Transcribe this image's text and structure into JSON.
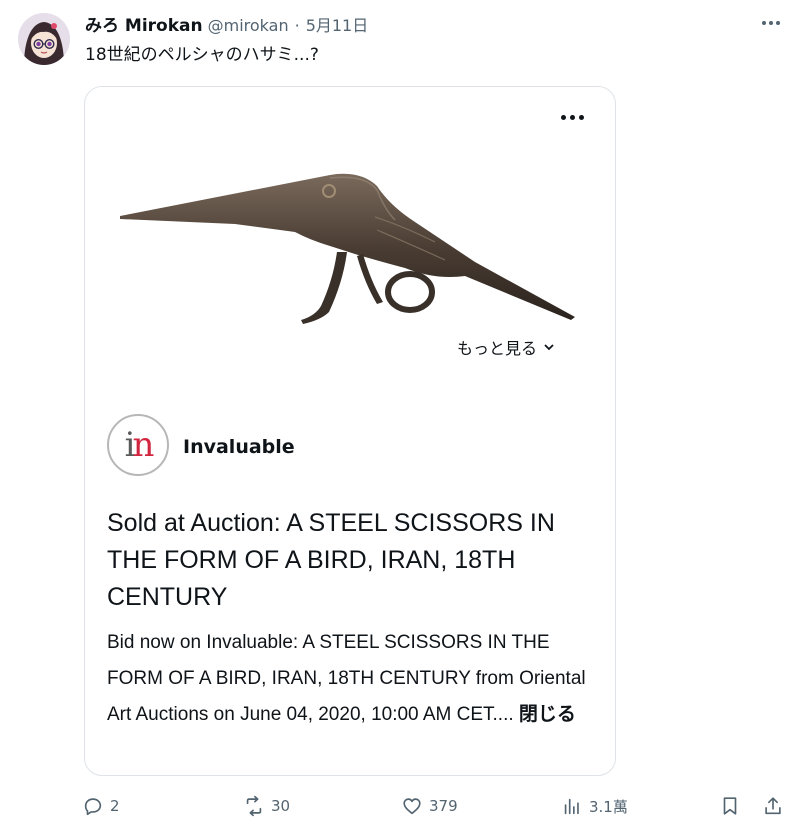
{
  "author": {
    "display_name": "みろ Mirokan",
    "handle": "@mirokan",
    "separator": "·",
    "date": "5月11日"
  },
  "tweet": {
    "text": "18世紀のペルシャのハサミ...?"
  },
  "card": {
    "see_more_label": "もっと見る",
    "brand_name": "Invaluable",
    "logo_letters": "in",
    "title": "Sold at Auction: A STEEL SCISSORS IN THE FORM OF A BIRD, IRAN, 18TH CENTURY",
    "description": "Bid now on Invaluable: A STEEL SCISSORS IN THE FORM OF A BIRD, IRAN, 18TH CENTURY from Oriental Art Auctions on June 04, 2020, 10:00 AM CET....",
    "close_label": "閉じる"
  },
  "actions": {
    "replies": "2",
    "reposts": "30",
    "likes": "379",
    "views": "3.1萬"
  },
  "colors": {
    "text": "#0f1419",
    "muted": "#536471",
    "border": "#dfe3e7",
    "brand_accent": "#d2253f"
  },
  "icons": {
    "avatar": "anime-avatar",
    "more": "more-horizontal-icon",
    "chevron": "chevron-down-icon",
    "reply": "reply-icon",
    "repost": "repost-icon",
    "like": "heart-icon",
    "views": "views-chart-icon",
    "bookmark": "bookmark-icon",
    "share": "share-icon"
  }
}
